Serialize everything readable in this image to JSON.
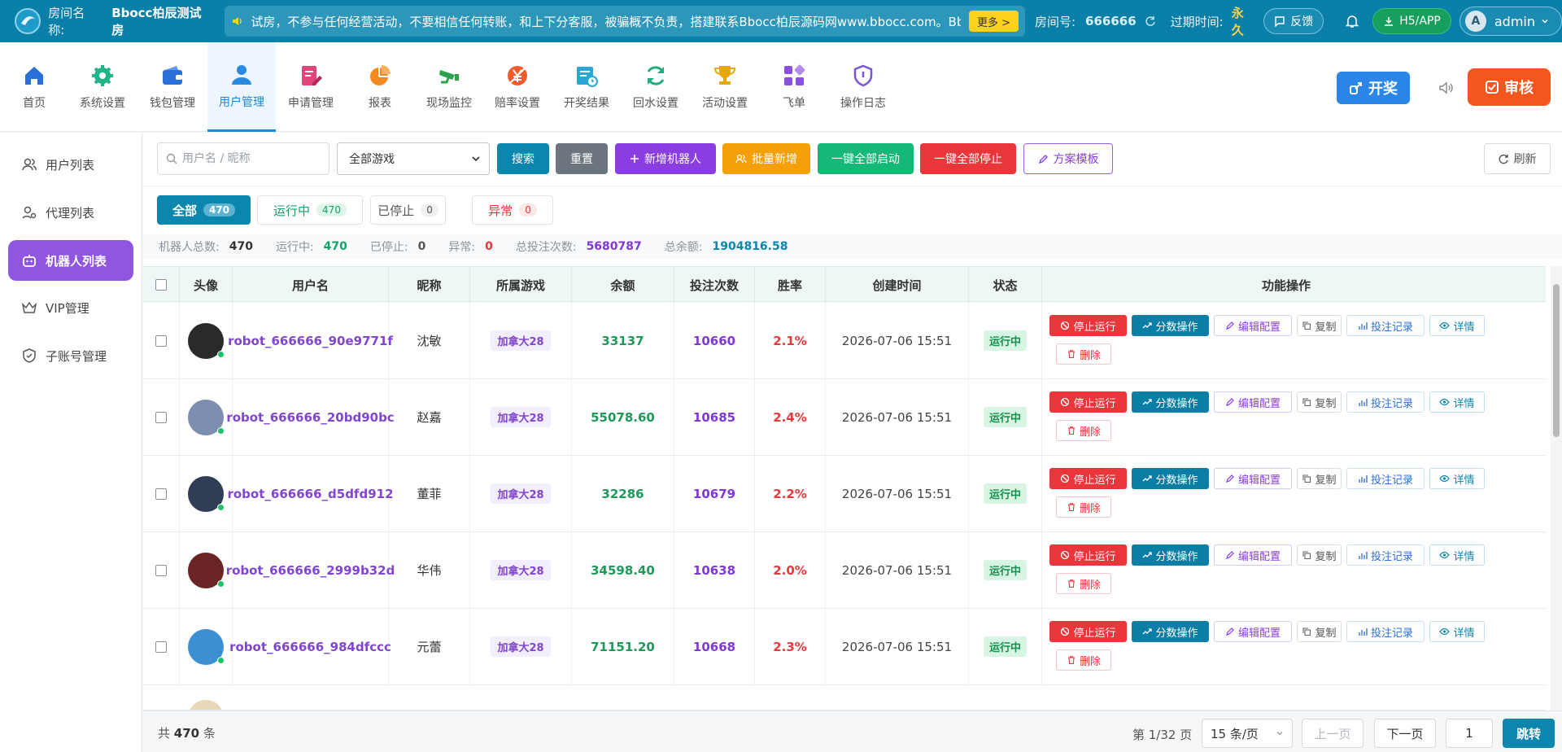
{
  "topbar": {
    "room_name_label": "房间名称:",
    "room_name": "Bbocc柏辰测试房",
    "notice": "试房，不参与任何经营活动，不要相信任何转账，和上下分客服，被骗概不负责，搭建联系Bbocc柏辰源码网www.bbocc.com。Bbo",
    "more_label": "更多 >",
    "room_no_label": "房间号:",
    "room_no": "666666",
    "expire_label": "过期时间:",
    "expire_value": "永久",
    "feedback_label": "反馈",
    "h5_label": "H5/APP",
    "avatar_letter": "A",
    "user": "admin"
  },
  "nav": {
    "items": [
      {
        "label": "首页",
        "icon": "home-icon"
      },
      {
        "label": "系统设置",
        "icon": "gear-icon"
      },
      {
        "label": "钱包管理",
        "icon": "wallet-icon"
      },
      {
        "label": "用户管理",
        "icon": "user-icon"
      },
      {
        "label": "申请管理",
        "icon": "edit-doc-icon"
      },
      {
        "label": "报表",
        "icon": "pie-chart-icon"
      },
      {
        "label": "现场监控",
        "icon": "camera-icon"
      },
      {
        "label": "赔率设置",
        "icon": "odds-icon"
      },
      {
        "label": "开奖结果",
        "icon": "result-icon"
      },
      {
        "label": "回水设置",
        "icon": "refresh-icon"
      },
      {
        "label": "活动设置",
        "icon": "trophy-icon"
      },
      {
        "label": "飞单",
        "icon": "grid-icon"
      },
      {
        "label": "操作日志",
        "icon": "shield-icon"
      }
    ],
    "draw_label": "开奖",
    "audit_label": "审核"
  },
  "sidebar": {
    "items": [
      {
        "label": "用户列表"
      },
      {
        "label": "代理列表"
      },
      {
        "label": "机器人列表"
      },
      {
        "label": "VIP管理"
      },
      {
        "label": "子账号管理"
      }
    ]
  },
  "toolbar": {
    "search_placeholder": "用户名 / 昵称",
    "game_select": "全部游戏",
    "search": "搜索",
    "reset": "重置",
    "add_robot": "新增机器人",
    "batch_add": "批量新增",
    "start_all": "一键全部启动",
    "stop_all": "一键全部停止",
    "template": "方案模板",
    "refresh": "刷新"
  },
  "tabs": [
    {
      "label": "全部",
      "count": "470"
    },
    {
      "label": "运行中",
      "count": "470"
    },
    {
      "label": "已停止",
      "count": "0"
    },
    {
      "label": "异常",
      "count": "0"
    }
  ],
  "stats": {
    "total_label": "机器人总数:",
    "total": "470",
    "running_label": "运行中:",
    "running": "470",
    "stopped_label": "已停止:",
    "stopped": "0",
    "abnormal_label": "异常:",
    "abnormal": "0",
    "bets_label": "总投注次数:",
    "bets": "5680787",
    "balance_label": "总余额:",
    "balance": "1904816.58"
  },
  "table": {
    "headers": [
      "头像",
      "用户名",
      "昵称",
      "所属游戏",
      "余额",
      "投注次数",
      "胜率",
      "创建时间",
      "状态",
      "功能操作"
    ],
    "actions": {
      "stop": "停止运行",
      "score": "分数操作",
      "edit": "编辑配置",
      "copy": "复制",
      "bets": "投注记录",
      "detail": "详情",
      "delete": "删除"
    },
    "rows": [
      {
        "username": "robot_666666_90e9771f",
        "nickname": "沈敏",
        "game": "加拿大28",
        "balance": "33137",
        "bets": "10660",
        "rate": "2.1%",
        "created": "2026-07-06 15:51",
        "status": "运行中",
        "avatar_color": "#2a2a2a"
      },
      {
        "username": "robot_666666_20bd90bc",
        "nickname": "赵嘉",
        "game": "加拿大28",
        "balance": "55078.60",
        "bets": "10685",
        "rate": "2.4%",
        "created": "2026-07-06 15:51",
        "status": "运行中",
        "avatar_color": "#7d8fb0"
      },
      {
        "username": "robot_666666_d5dfd912",
        "nickname": "董菲",
        "game": "加拿大28",
        "balance": "32286",
        "bets": "10679",
        "rate": "2.2%",
        "created": "2026-07-06 15:51",
        "status": "运行中",
        "avatar_color": "#2f3d55"
      },
      {
        "username": "robot_666666_2999b32d",
        "nickname": "华伟",
        "game": "加拿大28",
        "balance": "34598.40",
        "bets": "10638",
        "rate": "2.0%",
        "created": "2026-07-06 15:51",
        "status": "运行中",
        "avatar_color": "#6b2424"
      },
      {
        "username": "robot_666666_984dfccc",
        "nickname": "元蕾",
        "game": "加拿大28",
        "balance": "71151.20",
        "bets": "10668",
        "rate": "2.3%",
        "created": "2026-07-06 15:51",
        "status": "运行中",
        "avatar_color": "#3d8fd4"
      }
    ]
  },
  "pager": {
    "total_prefix": "共",
    "total": "470",
    "total_suffix": "条",
    "page_info": "第 1/32 页",
    "page_size": "15 条/页",
    "prev": "上一页",
    "next": "下一页",
    "page_input": "1",
    "jump": "跳转"
  }
}
